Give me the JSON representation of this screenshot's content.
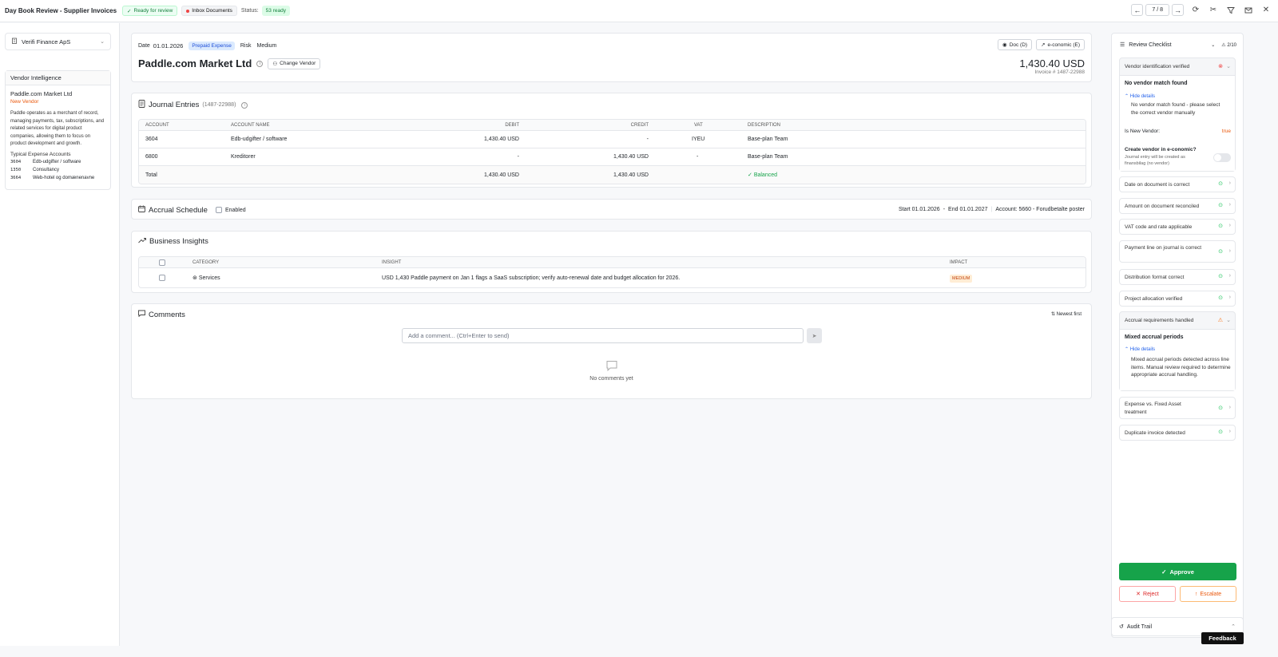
{
  "topbar": {
    "title": "Day Book Review - Supplier Invoices",
    "ready_label": "Ready for review",
    "inbox_label": "Inbox Documents",
    "status_label": "Status:",
    "status_count": "53 ready",
    "nav_count": "7 / 8"
  },
  "left": {
    "company": "Verifi Finance ApS",
    "vi_title": "Vendor Intelligence",
    "vendor_name": "Paddle.com Market Ltd",
    "new_vendor": "New Vendor",
    "description": "Paddle operates as a merchant of record, managing payments, tax, subscriptions, and related services for digital product companies, allowing them to focus on product development and growth.",
    "accounts_title": "Typical Expense Accounts",
    "accounts": [
      {
        "num": "3604",
        "name": "Edb-udgifter / software"
      },
      {
        "num": "1350",
        "name": "Consultancy"
      },
      {
        "num": "3664",
        "name": "Web-hotel og domænenavne"
      }
    ]
  },
  "header": {
    "date_label": "Date",
    "date": "01.01.2026",
    "badge": "Prepaid Expense",
    "risk_label": "Risk",
    "risk": "Medium",
    "vendor": "Paddle.com Market Ltd",
    "change_vendor": "Change Vendor",
    "doc_btn": "Doc (D)",
    "eco_btn": "e-conomic (E)",
    "amount": "1,430.40 USD",
    "invoice": "Invoice # 1487-22988"
  },
  "journal": {
    "title": "Journal Entries",
    "ref": "(1487-22988)",
    "headers": {
      "account": "Account",
      "name": "Account Name",
      "debit": "Debit",
      "credit": "Credit",
      "vat": "VAT",
      "desc": "Description"
    },
    "rows": [
      {
        "account": "3604",
        "name": "Edb-udgifter / software",
        "debit": "1,430.40 USD",
        "credit": "-",
        "vat": "IYEU",
        "desc": "Base-plan Team"
      },
      {
        "account": "6800",
        "name": "Kreditorer",
        "debit": "-",
        "credit": "1,430.40 USD",
        "vat": "-",
        "desc": "Base-plan Team"
      }
    ],
    "total": {
      "label": "Total",
      "debit": "1,430.40 USD",
      "credit": "1,430.40 USD",
      "status": "Balanced"
    }
  },
  "accrual": {
    "title": "Accrual Schedule",
    "enabled": "Enabled",
    "start": "Start 01.01.2026",
    "sep": "-",
    "end": "End 01.01.2027",
    "account": "Account: 5660 - Forudbetalte poster"
  },
  "insights": {
    "title": "Business Insights",
    "headers": {
      "category": "Category",
      "insight": "Insight",
      "impact": "Impact"
    },
    "rows": [
      {
        "category": "Services",
        "insight": "USD 1,430 Paddle payment on Jan 1 flags a SaaS subscription; verify auto-renewal date and budget allocation for 2026.",
        "impact": "MEDIUM"
      }
    ]
  },
  "comments": {
    "title": "Comments",
    "sort": "Newest first",
    "placeholder": "Add a comment... (Ctrl+Enter to send)",
    "empty": "No comments yet"
  },
  "checklist": {
    "title": "Review Checklist",
    "count": "2/10",
    "vendor_item": {
      "label": "Vendor identification verified",
      "heading": "No vendor match found",
      "hide": "Hide details",
      "detail": "No vendor match found - please select the correct vendor manually",
      "is_new_label": "Is New Vendor:",
      "is_new_value": "true",
      "create_label": "Create vendor in e-conomic?",
      "create_sub": "Journal entry will be created as finansbilag (no vendor)"
    },
    "items_a": [
      "Date on document is correct",
      "Amount on document reconciled",
      "VAT code and rate applicable",
      "Payment line on journal is correct",
      "Distribution format correct",
      "Project allocation verified"
    ],
    "accrual_item": {
      "label": "Accrual requirements handled",
      "heading": "Mixed accrual periods",
      "hide": "Hide details",
      "detail": "Mixed accrual periods detected across line items. Manual review required to determine appropriate accrual handling."
    },
    "items_b": [
      "Expense vs. Fixed Asset treatment",
      "Duplicate invoice detected"
    ],
    "approve": "Approve",
    "reject": "Reject",
    "escalate": "Escalate",
    "audit": "Audit Trail",
    "feedback": "Feedback"
  }
}
